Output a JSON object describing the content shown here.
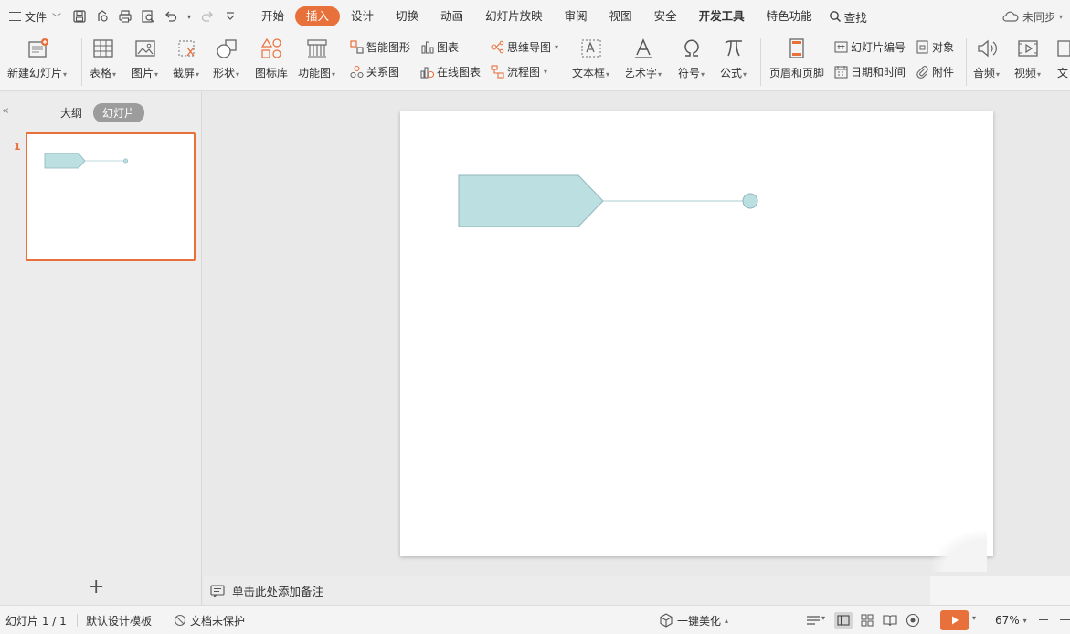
{
  "menubar": {
    "file_label": "文件",
    "tabs": [
      "开始",
      "插入",
      "设计",
      "切换",
      "动画",
      "幻灯片放映",
      "审阅",
      "视图",
      "安全",
      "开发工具",
      "特色功能"
    ],
    "active_tab": "插入",
    "search_label": "查找",
    "sync_label": "未同步"
  },
  "ribbon": {
    "new_slide": "新建幻灯片",
    "table": "表格",
    "picture": "图片",
    "screenshot": "截屏",
    "shape": "形状",
    "icon_lib": "图标库",
    "func_chart": "功能图",
    "smart_shape": "智能图形",
    "chart": "图表",
    "relation": "关系图",
    "online_chart": "在线图表",
    "mindmap": "思维导图",
    "flowchart": "流程图",
    "textbox": "文本框",
    "wordart": "艺术字",
    "symbol": "符号",
    "formula": "公式",
    "header_footer": "页眉和页脚",
    "slide_number": "幻灯片编号",
    "object": "对象",
    "date_time": "日期和时间",
    "attachment": "附件",
    "audio": "音频",
    "video": "视频",
    "text_more": "文"
  },
  "left_panel": {
    "outline_tab": "大纲",
    "slides_tab": "幻灯片",
    "slide_number": "1"
  },
  "notes": {
    "placeholder": "单击此处添加备注"
  },
  "status": {
    "slide_counter": "幻灯片 1 / 1",
    "template": "默认设计模板",
    "protection": "文档未保护",
    "beautify": "一键美化",
    "zoom": "67%"
  },
  "colors": {
    "accent": "#e8703a",
    "shape_fill": "#bcdfe2",
    "shape_stroke": "#8fb7bc",
    "connector": "#a9cdd2"
  }
}
